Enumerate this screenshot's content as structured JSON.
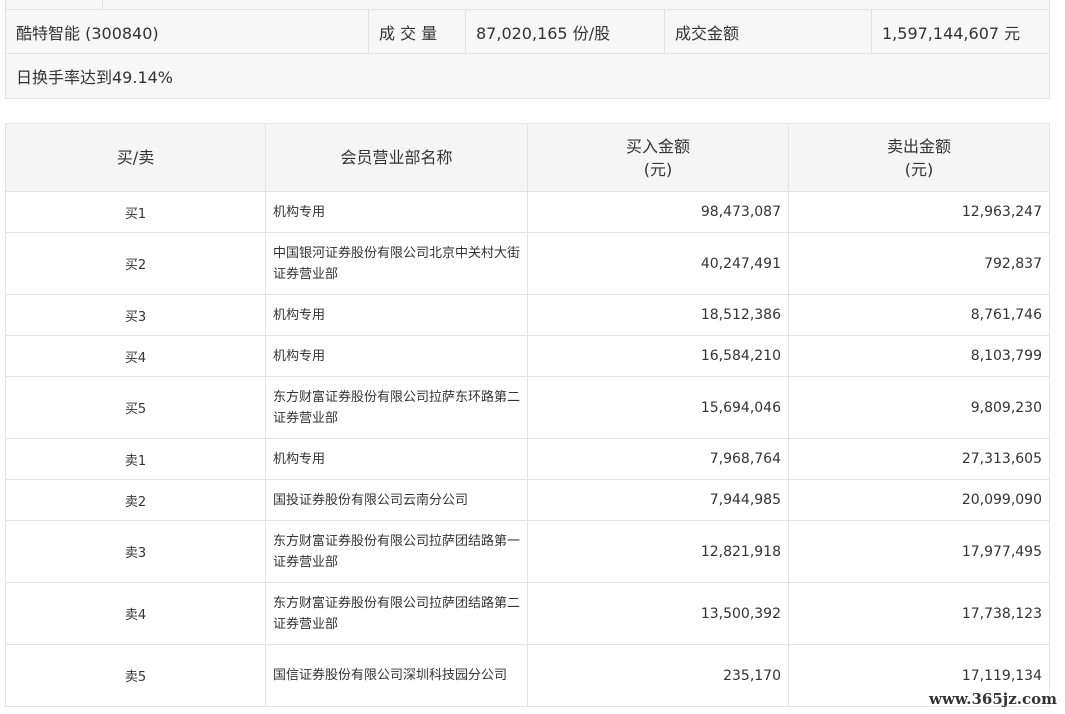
{
  "summary": {
    "stock_name": "酷特智能 (300840)",
    "volume_label": "成 交 量",
    "volume_value": "87,020,165 份/股",
    "amount_label": "成交金额",
    "amount_value": "1,597,144,607 元",
    "note": "日换手率达到49.14%"
  },
  "table": {
    "headers": {
      "side": "买/卖",
      "name": "会员营业部名称",
      "buy": "买入金额\n(元)",
      "sell": "卖出金额\n(元)"
    },
    "rows": [
      {
        "side": "买1",
        "name": "机构专用",
        "buy": "98,473,087",
        "sell": "12,963,247"
      },
      {
        "side": "买2",
        "name": "中国银河证券股份有限公司北京中关村大街证券营业部",
        "buy": "40,247,491",
        "sell": "792,837"
      },
      {
        "side": "买3",
        "name": "机构专用",
        "buy": "18,512,386",
        "sell": "8,761,746"
      },
      {
        "side": "买4",
        "name": "机构专用",
        "buy": "16,584,210",
        "sell": "8,103,799"
      },
      {
        "side": "买5",
        "name": "东方财富证券股份有限公司拉萨东环路第二证券营业部",
        "buy": "15,694,046",
        "sell": "9,809,230"
      },
      {
        "side": "卖1",
        "name": "机构专用",
        "buy": "7,968,764",
        "sell": "27,313,605"
      },
      {
        "side": "卖2",
        "name": "国投证券股份有限公司云南分公司",
        "buy": "7,944,985",
        "sell": "20,099,090"
      },
      {
        "side": "卖3",
        "name": "东方财富证券股份有限公司拉萨团结路第一证券营业部",
        "buy": "12,821,918",
        "sell": "17,977,495"
      },
      {
        "side": "卖4",
        "name": "东方财富证券股份有限公司拉萨团结路第二证券营业部",
        "buy": "13,500,392",
        "sell": "17,738,123"
      },
      {
        "side": "卖5",
        "name": "国信证券股份有限公司深圳科技园分公司",
        "buy": "235,170",
        "sell": "17,119,134"
      }
    ]
  },
  "watermark": "www.365jz.com"
}
